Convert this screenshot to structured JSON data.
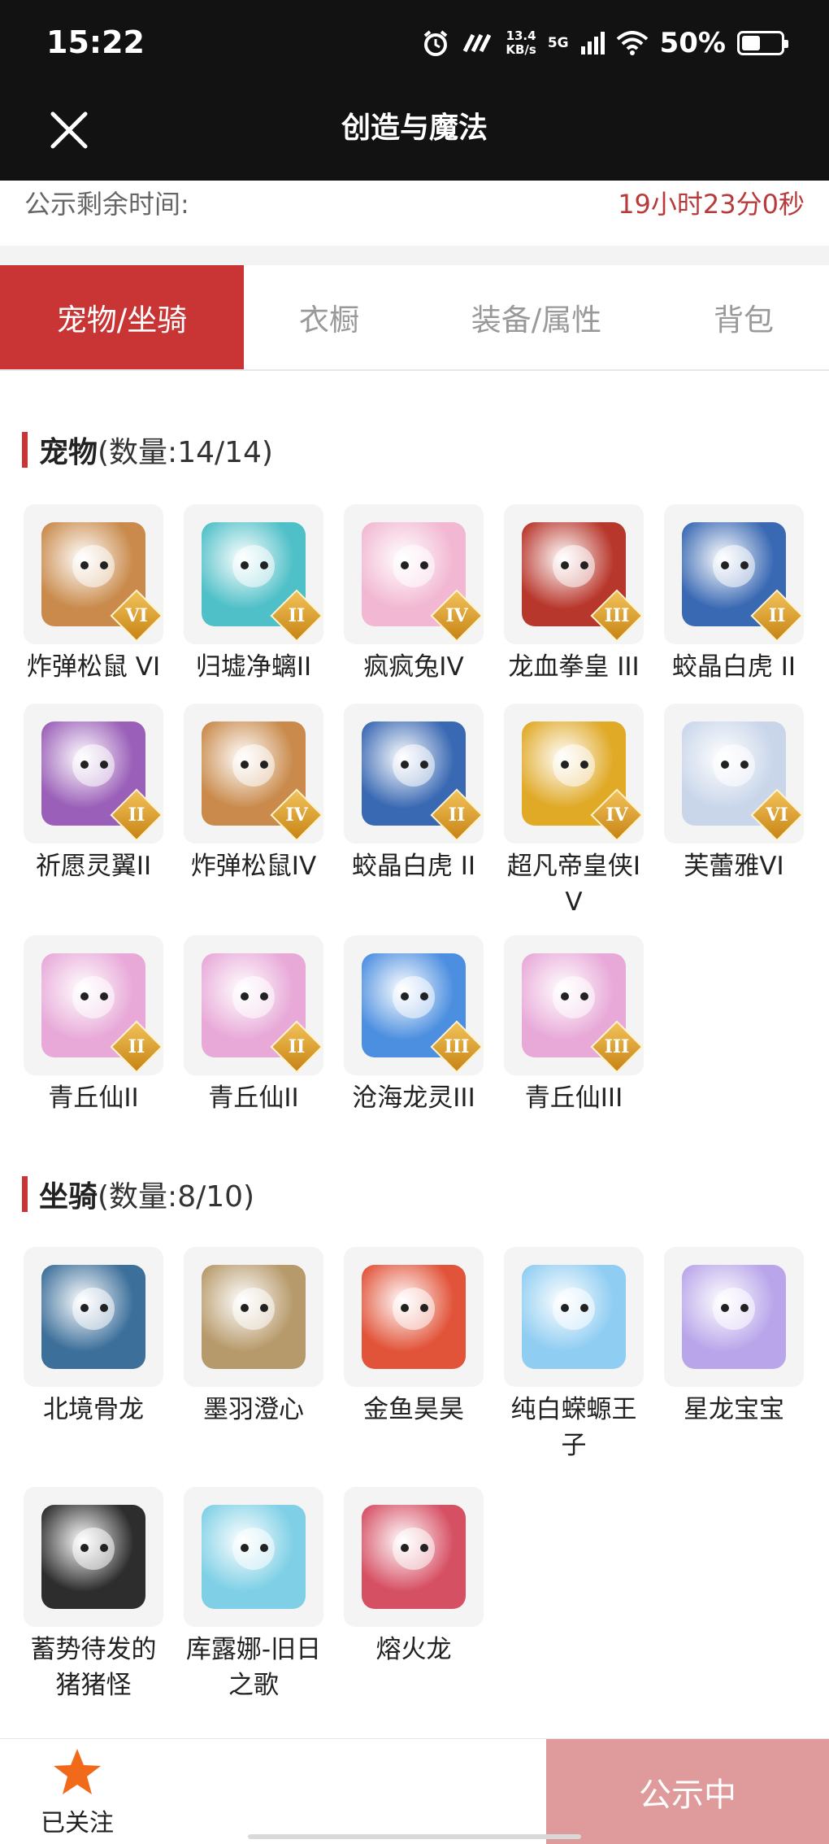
{
  "status_bar": {
    "time": "15:22",
    "net_speed_value": "13.4",
    "net_speed_unit": "KB/s",
    "network": "5G",
    "battery_percent": "50%",
    "battery_level": 0.5
  },
  "nav": {
    "title": "创造与魔法",
    "close_icon": "close-icon"
  },
  "notice": {
    "label": "公示剩余时间:",
    "countdown": "19小时23分0秒"
  },
  "tabs": [
    {
      "label": "宠物/坐骑",
      "active": true
    },
    {
      "label": "衣橱",
      "active": false
    },
    {
      "label": "装备/属性",
      "active": false
    },
    {
      "label": "背包",
      "active": false
    }
  ],
  "pets": {
    "title": "宠物",
    "count": "(数量:14/14)",
    "items": [
      {
        "name": "炸弹松鼠 VI",
        "badge": "VI",
        "color": "#c98a4b"
      },
      {
        "name": "归墟净螭II",
        "badge": "II",
        "color": "#4fc0c8"
      },
      {
        "name": "疯疯兔IV",
        "badge": "IV",
        "color": "#f2b7d2"
      },
      {
        "name": "龙血拳皇 III",
        "badge": "III",
        "color": "#b8372c"
      },
      {
        "name": "蛟晶白虎 II",
        "badge": "II",
        "color": "#3a69b3"
      },
      {
        "name": "祈愿灵翼II",
        "badge": "II",
        "color": "#9a5fb8"
      },
      {
        "name": "炸弹松鼠IV",
        "badge": "IV",
        "color": "#c98a4b"
      },
      {
        "name": "蛟晶白虎 II",
        "badge": "II",
        "color": "#3a69b3"
      },
      {
        "name": "超凡帝皇侠IV",
        "badge": "IV",
        "color": "#e0a926"
      },
      {
        "name": "芙蕾雅VI",
        "badge": "VI",
        "color": "#c9d6ea"
      },
      {
        "name": "青丘仙II",
        "badge": "II",
        "color": "#e8a9d8"
      },
      {
        "name": "青丘仙II",
        "badge": "II",
        "color": "#e8a9d8"
      },
      {
        "name": "沧海龙灵III",
        "badge": "III",
        "color": "#4c8fe0"
      },
      {
        "name": "青丘仙III",
        "badge": "III",
        "color": "#e8a9d8"
      }
    ]
  },
  "mounts": {
    "title": "坐骑",
    "count": "(数量:8/10)",
    "items": [
      {
        "name": "北境骨龙",
        "color": "#3c6f9a"
      },
      {
        "name": "墨羽澄心",
        "color": "#b79a6b"
      },
      {
        "name": "金鱼昊昊",
        "color": "#e2543a"
      },
      {
        "name": "纯白蝾螈王子",
        "color": "#8fcdf2"
      },
      {
        "name": "星龙宝宝",
        "color": "#b9a6ea"
      },
      {
        "name": "蓄势待发的猪猪怪",
        "color": "#2d2d2d"
      },
      {
        "name": "库露娜-旧日之歌",
        "color": "#7fd0e6"
      },
      {
        "name": "熔火龙",
        "color": "#d65064"
      }
    ]
  },
  "bottom": {
    "follow_label": "已关注",
    "follow_icon": "star-icon",
    "status_button": "公示中",
    "accent_color": "#f06a1a"
  }
}
